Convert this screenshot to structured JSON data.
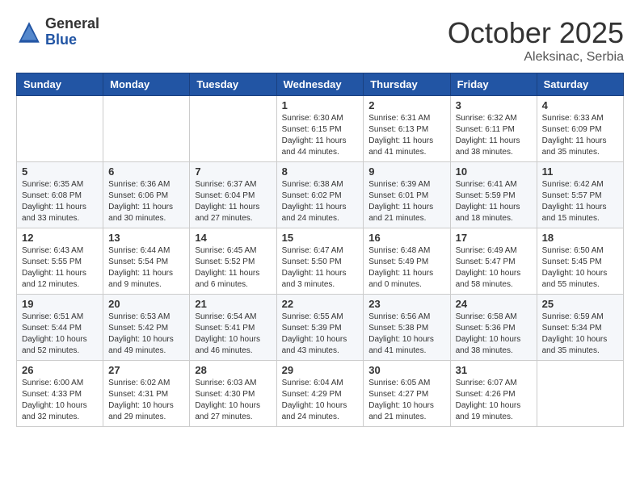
{
  "header": {
    "logo_general": "General",
    "logo_blue": "Blue",
    "month": "October 2025",
    "location": "Aleksinac, Serbia"
  },
  "days_of_week": [
    "Sunday",
    "Monday",
    "Tuesday",
    "Wednesday",
    "Thursday",
    "Friday",
    "Saturday"
  ],
  "weeks": [
    [
      {
        "day": "",
        "info": ""
      },
      {
        "day": "",
        "info": ""
      },
      {
        "day": "",
        "info": ""
      },
      {
        "day": "1",
        "info": "Sunrise: 6:30 AM\nSunset: 6:15 PM\nDaylight: 11 hours\nand 44 minutes."
      },
      {
        "day": "2",
        "info": "Sunrise: 6:31 AM\nSunset: 6:13 PM\nDaylight: 11 hours\nand 41 minutes."
      },
      {
        "day": "3",
        "info": "Sunrise: 6:32 AM\nSunset: 6:11 PM\nDaylight: 11 hours\nand 38 minutes."
      },
      {
        "day": "4",
        "info": "Sunrise: 6:33 AM\nSunset: 6:09 PM\nDaylight: 11 hours\nand 35 minutes."
      }
    ],
    [
      {
        "day": "5",
        "info": "Sunrise: 6:35 AM\nSunset: 6:08 PM\nDaylight: 11 hours\nand 33 minutes."
      },
      {
        "day": "6",
        "info": "Sunrise: 6:36 AM\nSunset: 6:06 PM\nDaylight: 11 hours\nand 30 minutes."
      },
      {
        "day": "7",
        "info": "Sunrise: 6:37 AM\nSunset: 6:04 PM\nDaylight: 11 hours\nand 27 minutes."
      },
      {
        "day": "8",
        "info": "Sunrise: 6:38 AM\nSunset: 6:02 PM\nDaylight: 11 hours\nand 24 minutes."
      },
      {
        "day": "9",
        "info": "Sunrise: 6:39 AM\nSunset: 6:01 PM\nDaylight: 11 hours\nand 21 minutes."
      },
      {
        "day": "10",
        "info": "Sunrise: 6:41 AM\nSunset: 5:59 PM\nDaylight: 11 hours\nand 18 minutes."
      },
      {
        "day": "11",
        "info": "Sunrise: 6:42 AM\nSunset: 5:57 PM\nDaylight: 11 hours\nand 15 minutes."
      }
    ],
    [
      {
        "day": "12",
        "info": "Sunrise: 6:43 AM\nSunset: 5:55 PM\nDaylight: 11 hours\nand 12 minutes."
      },
      {
        "day": "13",
        "info": "Sunrise: 6:44 AM\nSunset: 5:54 PM\nDaylight: 11 hours\nand 9 minutes."
      },
      {
        "day": "14",
        "info": "Sunrise: 6:45 AM\nSunset: 5:52 PM\nDaylight: 11 hours\nand 6 minutes."
      },
      {
        "day": "15",
        "info": "Sunrise: 6:47 AM\nSunset: 5:50 PM\nDaylight: 11 hours\nand 3 minutes."
      },
      {
        "day": "16",
        "info": "Sunrise: 6:48 AM\nSunset: 5:49 PM\nDaylight: 11 hours\nand 0 minutes."
      },
      {
        "day": "17",
        "info": "Sunrise: 6:49 AM\nSunset: 5:47 PM\nDaylight: 10 hours\nand 58 minutes."
      },
      {
        "day": "18",
        "info": "Sunrise: 6:50 AM\nSunset: 5:45 PM\nDaylight: 10 hours\nand 55 minutes."
      }
    ],
    [
      {
        "day": "19",
        "info": "Sunrise: 6:51 AM\nSunset: 5:44 PM\nDaylight: 10 hours\nand 52 minutes."
      },
      {
        "day": "20",
        "info": "Sunrise: 6:53 AM\nSunset: 5:42 PM\nDaylight: 10 hours\nand 49 minutes."
      },
      {
        "day": "21",
        "info": "Sunrise: 6:54 AM\nSunset: 5:41 PM\nDaylight: 10 hours\nand 46 minutes."
      },
      {
        "day": "22",
        "info": "Sunrise: 6:55 AM\nSunset: 5:39 PM\nDaylight: 10 hours\nand 43 minutes."
      },
      {
        "day": "23",
        "info": "Sunrise: 6:56 AM\nSunset: 5:38 PM\nDaylight: 10 hours\nand 41 minutes."
      },
      {
        "day": "24",
        "info": "Sunrise: 6:58 AM\nSunset: 5:36 PM\nDaylight: 10 hours\nand 38 minutes."
      },
      {
        "day": "25",
        "info": "Sunrise: 6:59 AM\nSunset: 5:34 PM\nDaylight: 10 hours\nand 35 minutes."
      }
    ],
    [
      {
        "day": "26",
        "info": "Sunrise: 6:00 AM\nSunset: 4:33 PM\nDaylight: 10 hours\nand 32 minutes."
      },
      {
        "day": "27",
        "info": "Sunrise: 6:02 AM\nSunset: 4:31 PM\nDaylight: 10 hours\nand 29 minutes."
      },
      {
        "day": "28",
        "info": "Sunrise: 6:03 AM\nSunset: 4:30 PM\nDaylight: 10 hours\nand 27 minutes."
      },
      {
        "day": "29",
        "info": "Sunrise: 6:04 AM\nSunset: 4:29 PM\nDaylight: 10 hours\nand 24 minutes."
      },
      {
        "day": "30",
        "info": "Sunrise: 6:05 AM\nSunset: 4:27 PM\nDaylight: 10 hours\nand 21 minutes."
      },
      {
        "day": "31",
        "info": "Sunrise: 6:07 AM\nSunset: 4:26 PM\nDaylight: 10 hours\nand 19 minutes."
      },
      {
        "day": "",
        "info": ""
      }
    ]
  ]
}
